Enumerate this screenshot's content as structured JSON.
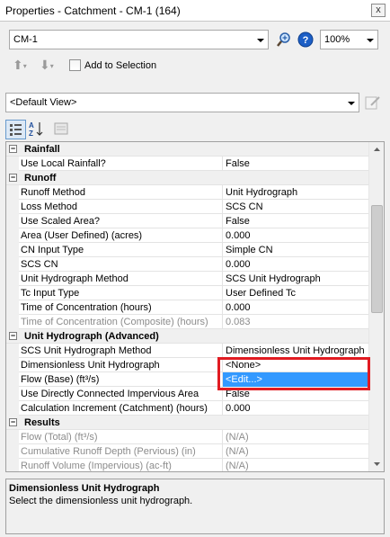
{
  "window": {
    "title": "Properties - Catchment - CM-1 (164)",
    "close_label": "x"
  },
  "toolbar": {
    "element_selector": "CM-1",
    "zoom": "100%",
    "add_to_selection_label": "Add to Selection",
    "view_selector": "<Default View>"
  },
  "grid": {
    "rows": [
      {
        "kind": "category",
        "name": "Rainfall"
      },
      {
        "kind": "property",
        "name": "Use Local Rainfall?",
        "value": "False"
      },
      {
        "kind": "category",
        "name": "Runoff"
      },
      {
        "kind": "property",
        "name": "Runoff Method",
        "value": "Unit Hydrograph"
      },
      {
        "kind": "property",
        "name": "Loss Method",
        "value": "SCS CN"
      },
      {
        "kind": "property",
        "name": "Use Scaled Area?",
        "value": "False"
      },
      {
        "kind": "property",
        "name": "Area (User Defined) (acres)",
        "value": "0.000"
      },
      {
        "kind": "property",
        "name": "CN Input Type",
        "value": "Simple CN"
      },
      {
        "kind": "property",
        "name": "SCS CN",
        "value": "0.000"
      },
      {
        "kind": "property",
        "name": "Unit Hydrograph Method",
        "value": "SCS Unit Hydrograph"
      },
      {
        "kind": "property",
        "name": "Tc Input Type",
        "value": "User Defined Tc"
      },
      {
        "kind": "property",
        "name": "Time of Concentration (hours)",
        "value": "0.000"
      },
      {
        "kind": "readonly",
        "name": "Time of Concentration (Composite) (hours)",
        "value": "0.083"
      },
      {
        "kind": "category",
        "name": "Unit Hydrograph (Advanced)"
      },
      {
        "kind": "property",
        "name": "SCS Unit Hydrograph Method",
        "value": "Dimensionless Unit Hydrograph"
      },
      {
        "kind": "property",
        "name": "Dimensionless Unit Hydrograph",
        "value": "<None>"
      },
      {
        "kind": "selected",
        "name": "Flow (Base) (ft³/s)",
        "value": "<Edit...>"
      },
      {
        "kind": "property",
        "name": "Use Directly Connected Impervious Area",
        "value": "False"
      },
      {
        "kind": "property",
        "name": "Calculation Increment (Catchment) (hours)",
        "value": "0.000"
      },
      {
        "kind": "category",
        "name": "Results"
      },
      {
        "kind": "readonly",
        "name": "Flow (Total) (ft³/s)",
        "value": "(N/A)"
      },
      {
        "kind": "readonly",
        "name": "Cumulative Runoff Depth (Pervious) (in)",
        "value": "(N/A)"
      },
      {
        "kind": "readonly",
        "name": "Runoff Volume (Impervious) (ac-ft)",
        "value": "(N/A)"
      }
    ]
  },
  "description": {
    "title": "Dimensionless Unit Hydrograph",
    "text": "Select the dimensionless unit hydrograph."
  },
  "colors": {
    "selection": "#3399ff",
    "highlight_box": "#e11b22",
    "readonly_text": "#8c8c8c"
  }
}
